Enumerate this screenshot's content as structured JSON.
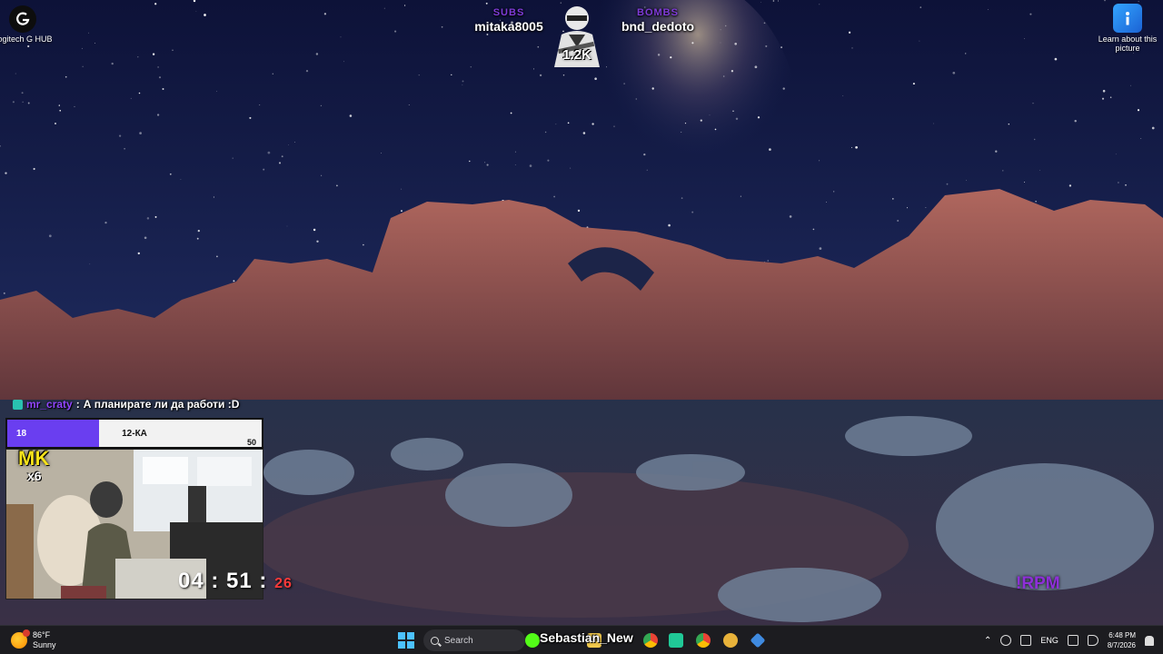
{
  "desktop": {
    "icons": [
      {
        "label": "Logitech G HUB",
        "icon": "logitech-g-icon"
      },
      {
        "label": "Learn about this picture",
        "icon": "info-picture-icon"
      }
    ]
  },
  "stream_overlay": {
    "top_subs": {
      "left_label": "SUBS",
      "left_name": "mitaka8005",
      "right_label": "BOMBS",
      "right_name": "bnd_dedoto",
      "mascot_count": "1.2K"
    },
    "chat": {
      "user": "mr_craty",
      "message": "А планирате ли да работи :D"
    },
    "goal": {
      "current": "18",
      "label": "12-КА",
      "max": "50",
      "fill_percent": 36,
      "fill_color": "#6a3ef0"
    },
    "webcam": {
      "badge": "MK",
      "multiplier": "x6",
      "timer_main": "04 : 51 :",
      "timer_seconds": "26"
    },
    "command": "!RPM",
    "stream_name": "Sebastian_New"
  },
  "taskbar": {
    "weather_temp": "86°F",
    "weather_desc": "Sunny",
    "search_placeholder": "Search",
    "language": "ENG",
    "time": "6:48 PM",
    "date": "8/7/2026",
    "apps": [
      "kick-app-icon",
      "file-explorer-icon",
      "chrome-icon",
      "audio-app-icon",
      "chrome-icon",
      "app-yellow-icon",
      "app-diamond-icon"
    ]
  },
  "colors": {
    "accent_purple": "#7f3bd8",
    "taskbar_bg": "#1c1c20",
    "timer_seconds": "#ff3a3a"
  }
}
